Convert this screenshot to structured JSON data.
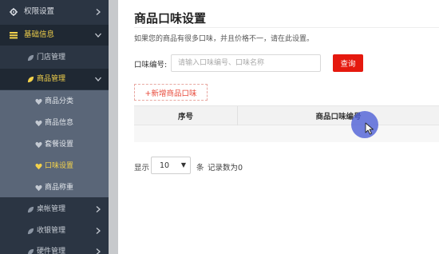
{
  "sidebar": {
    "top_items": [
      {
        "label": "权限设置",
        "icon": "gear-icon"
      },
      {
        "label": "基础信息",
        "icon": "list-icon"
      }
    ],
    "basic_children": [
      {
        "label": "门店管理",
        "icon": "leaf-icon"
      },
      {
        "label": "商品管理",
        "icon": "leaf-icon"
      }
    ],
    "goods_children": [
      {
        "label": "商品分类",
        "icon": "heart-icon"
      },
      {
        "label": "商品信息",
        "icon": "heart-icon"
      },
      {
        "label": "套餐设置",
        "icon": "heart-icon"
      },
      {
        "label": "口味设置",
        "icon": "heart-icon"
      },
      {
        "label": "商品称重",
        "icon": "heart-icon"
      }
    ],
    "bottom_items": [
      {
        "label": "桌帐管理",
        "icon": "leaf-icon"
      },
      {
        "label": "收银管理",
        "icon": "leaf-icon"
      },
      {
        "label": "硬件管理",
        "icon": "leaf-icon"
      }
    ],
    "colors": {
      "bg": "#2b3543",
      "active_bg": "#1f2833",
      "sub_bg": "#5a6678",
      "highlight": "#f3d24b"
    }
  },
  "page": {
    "title": "商品口味设置",
    "description": "如果您的商品有很多口味，并且价格不一，请在此设置。"
  },
  "filter": {
    "label": "口味编号:",
    "placeholder": "请输入口味编号、口味名称",
    "search_label": "查询"
  },
  "add_button": "+新增商品口味",
  "table": {
    "columns": [
      "序号",
      "商品口味编号"
    ]
  },
  "pagination": {
    "show_label": "显示",
    "page_size": "10",
    "unit": "条",
    "record_count": "记录数为0"
  }
}
